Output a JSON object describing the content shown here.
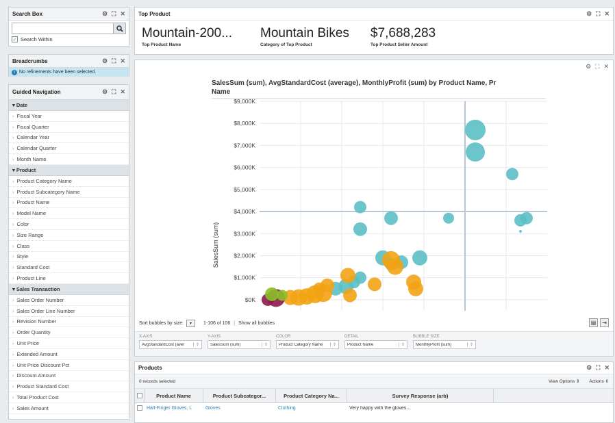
{
  "search_box": {
    "title": "Search Box",
    "value": "",
    "search_within": "Search Within"
  },
  "breadcrumbs": {
    "title": "Breadcrumbs",
    "message": "No refinements have been selected."
  },
  "guided_nav": {
    "title": "Guided Navigation",
    "sections": [
      {
        "name": "Date",
        "items": [
          "Fiscal Year",
          "Fiscal Quarter",
          "Calendar Year",
          "Calendar Quarter",
          "Month Name"
        ]
      },
      {
        "name": "Product",
        "items": [
          "Product Category Name",
          "Product Subcategory Name",
          "Product Name",
          "Model Name",
          "Color",
          "Size Range",
          "Class",
          "Style",
          "Standard Cost",
          "Product Line"
        ]
      },
      {
        "name": "Sales Transaction",
        "items": [
          "Sales Order Number",
          "Sales Order Line Number",
          "Revision Number",
          "Order Quantity",
          "Unit Price",
          "Extended Amount",
          "Unit Price Discount Pct",
          "Discount Amount",
          "Product Standard Cost",
          "Total Product Cost",
          "Sales Amount"
        ]
      }
    ]
  },
  "top_product": {
    "title": "Top Product",
    "metrics": [
      {
        "value": "Mountain-200...",
        "label": "Top Product Name"
      },
      {
        "value": "Mountain Bikes",
        "label": "Category of Top Product"
      },
      {
        "value": "$7,688,283",
        "label": "Top Product Seller Amount"
      }
    ]
  },
  "chart_panel": {
    "sort_label": "Sort bubbles by size:",
    "range_text": "1-106 of 106",
    "show_all": "Show all bubbles",
    "shelves": [
      {
        "label": "X-AXIS",
        "value": "AvgStandardCost (aver"
      },
      {
        "label": "Y-AXIS",
        "value": "SalesSum (sum)"
      },
      {
        "label": "COLOR",
        "value": "Product Category Name"
      },
      {
        "label": "DETAIL",
        "value": "Product Name"
      },
      {
        "label": "BUBBLE SIZE",
        "value": "MonthlyProfit (sum)"
      }
    ]
  },
  "chart_data": {
    "type": "scatter",
    "title_line1": "SalesSum (sum), AvgStandardCost (average), MonthlyProfit (sum) by Product Name, Pr",
    "title_line2": "Name",
    "ylabel": "SalesSum (sum)",
    "ylim": [
      -500,
      9000
    ],
    "yticks": [
      "$0K",
      "$1,000K",
      "$2,000K",
      "$3,000K",
      "$4,000K",
      "$5,000K",
      "$6,000K",
      "$7,000K",
      "$8,000K",
      "$9,000K"
    ],
    "ref_x": 1000,
    "ref_y": 4000,
    "colors": {
      "bikes": "#5bbfc4",
      "components": "#f2a314",
      "clothing": "#8cbf2a",
      "accessories": "#8b1a4a"
    },
    "points": [
      {
        "x": 1050,
        "y": 7700,
        "r": 15,
        "c": "bikes"
      },
      {
        "x": 1050,
        "y": 6700,
        "r": 14,
        "c": "bikes"
      },
      {
        "x": 1230,
        "y": 5700,
        "r": 9,
        "c": "bikes"
      },
      {
        "x": 920,
        "y": 3700,
        "r": 8,
        "c": "bikes"
      },
      {
        "x": 1270,
        "y": 3600,
        "r": 9,
        "c": "bikes"
      },
      {
        "x": 1300,
        "y": 3700,
        "r": 9,
        "c": "bikes"
      },
      {
        "x": 1270,
        "y": 3100,
        "r": 2,
        "c": "bikes"
      },
      {
        "x": 490,
        "y": 4200,
        "r": 9,
        "c": "bikes"
      },
      {
        "x": 640,
        "y": 3700,
        "r": 10,
        "c": "bikes"
      },
      {
        "x": 490,
        "y": 3200,
        "r": 10,
        "c": "bikes"
      },
      {
        "x": 600,
        "y": 1900,
        "r": 11,
        "c": "bikes"
      },
      {
        "x": 690,
        "y": 1700,
        "r": 10,
        "c": "bikes"
      },
      {
        "x": 780,
        "y": 1900,
        "r": 11,
        "c": "bikes"
      },
      {
        "x": 640,
        "y": 1600,
        "r": 9,
        "c": "bikes"
      },
      {
        "x": 490,
        "y": 1000,
        "r": 9,
        "c": "bikes"
      },
      {
        "x": 460,
        "y": 800,
        "r": 9,
        "c": "bikes"
      },
      {
        "x": 420,
        "y": 600,
        "r": 11,
        "c": "bikes"
      },
      {
        "x": 370,
        "y": 500,
        "r": 10,
        "c": "bikes"
      },
      {
        "x": 640,
        "y": 1800,
        "r": 13,
        "c": "components"
      },
      {
        "x": 660,
        "y": 1500,
        "r": 12,
        "c": "components"
      },
      {
        "x": 750,
        "y": 800,
        "r": 11,
        "c": "components"
      },
      {
        "x": 760,
        "y": 500,
        "r": 11,
        "c": "components"
      },
      {
        "x": 560,
        "y": 700,
        "r": 10,
        "c": "components"
      },
      {
        "x": 430,
        "y": 1100,
        "r": 11,
        "c": "components"
      },
      {
        "x": 440,
        "y": 200,
        "r": 10,
        "c": "components"
      },
      {
        "x": 330,
        "y": 650,
        "r": 10,
        "c": "components"
      },
      {
        "x": 310,
        "y": 300,
        "r": 13,
        "c": "components"
      },
      {
        "x": 270,
        "y": 250,
        "r": 13,
        "c": "components"
      },
      {
        "x": 230,
        "y": 150,
        "r": 12,
        "c": "components"
      },
      {
        "x": 190,
        "y": 100,
        "r": 12,
        "c": "components"
      },
      {
        "x": 150,
        "y": 100,
        "r": 11,
        "c": "components"
      },
      {
        "x": 290,
        "y": 500,
        "r": 9,
        "c": "components"
      },
      {
        "x": 80,
        "y": 80,
        "r": 13,
        "c": "accessories"
      },
      {
        "x": 40,
        "y": 0,
        "r": 9,
        "c": "accessories"
      },
      {
        "x": 60,
        "y": 250,
        "r": 10,
        "c": "clothing"
      },
      {
        "x": 110,
        "y": 200,
        "r": 8,
        "c": "clothing"
      }
    ]
  },
  "products": {
    "title": "Products",
    "selected": "0 records selected",
    "view_options": "View Options",
    "actions": "Actions",
    "columns": [
      "Product Name",
      "Product Subcategor...",
      "Product Category Na...",
      "Survey Response (arb)"
    ],
    "row": [
      "Half-Finger Gloves, L",
      "Gloves",
      "Clothing",
      "Very happy with the gloves..."
    ]
  }
}
